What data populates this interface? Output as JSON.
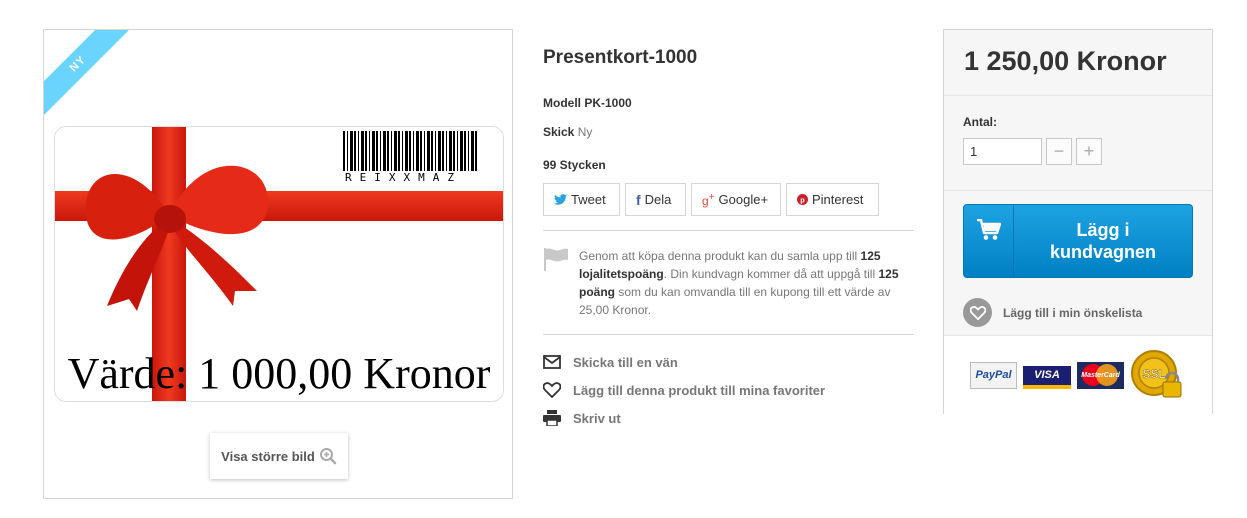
{
  "product": {
    "badge": "Ny",
    "title": "Presentkort-1000",
    "model_label": "Modell",
    "model_value": "PK-1000",
    "condition_label": "Skick",
    "condition_value": "Ny",
    "stock": "99 Stycken",
    "image": {
      "barcode_text": "REIXXMAZ",
      "value_text": "Värde: 1 000,00 Kronor"
    },
    "zoom_label": "Visa större bild"
  },
  "share": {
    "tweet": "Tweet",
    "dela": "Dela",
    "google": "Google+",
    "pinterest": "Pinterest"
  },
  "loyalty": {
    "t1": "Genom att köpa denna produkt kan du samla upp till ",
    "b1": "125 lojalitetspoäng",
    "t2": ". Din kundvagn kommer då att uppgå till ",
    "b2": "125 poäng",
    "t3": " som du kan omvandla till en kupong till ett värde av 25,00 Kronor."
  },
  "links": {
    "send_friend": "Skicka till en vän",
    "favorites": "Lägg till denna produkt till mina favoriter",
    "print": "Skriv ut"
  },
  "buy": {
    "price": "1 250,00 Kronor",
    "qty_label": "Antal:",
    "qty_value": "1",
    "qty_minus": "−",
    "qty_plus": "+",
    "cart_label_line1": "Lägg i",
    "cart_label_line2": "kundvagnen",
    "wishlist": "Lägg till i min önskelista"
  },
  "payment": {
    "paypal": "PayPal",
    "visa": "VISA",
    "mastercard": "MasterCard"
  },
  "icons": [
    "twitter-icon",
    "facebook-icon",
    "google-plus-icon",
    "pinterest-icon",
    "flag-icon",
    "envelope-icon",
    "heart-icon",
    "printer-icon",
    "cart-icon",
    "zoom-icon",
    "ssl-seal-icon"
  ],
  "colors": {
    "accent_blue": "#0079b6",
    "ribbon": "#6ad4ff",
    "gift_red": "#e3261a"
  }
}
